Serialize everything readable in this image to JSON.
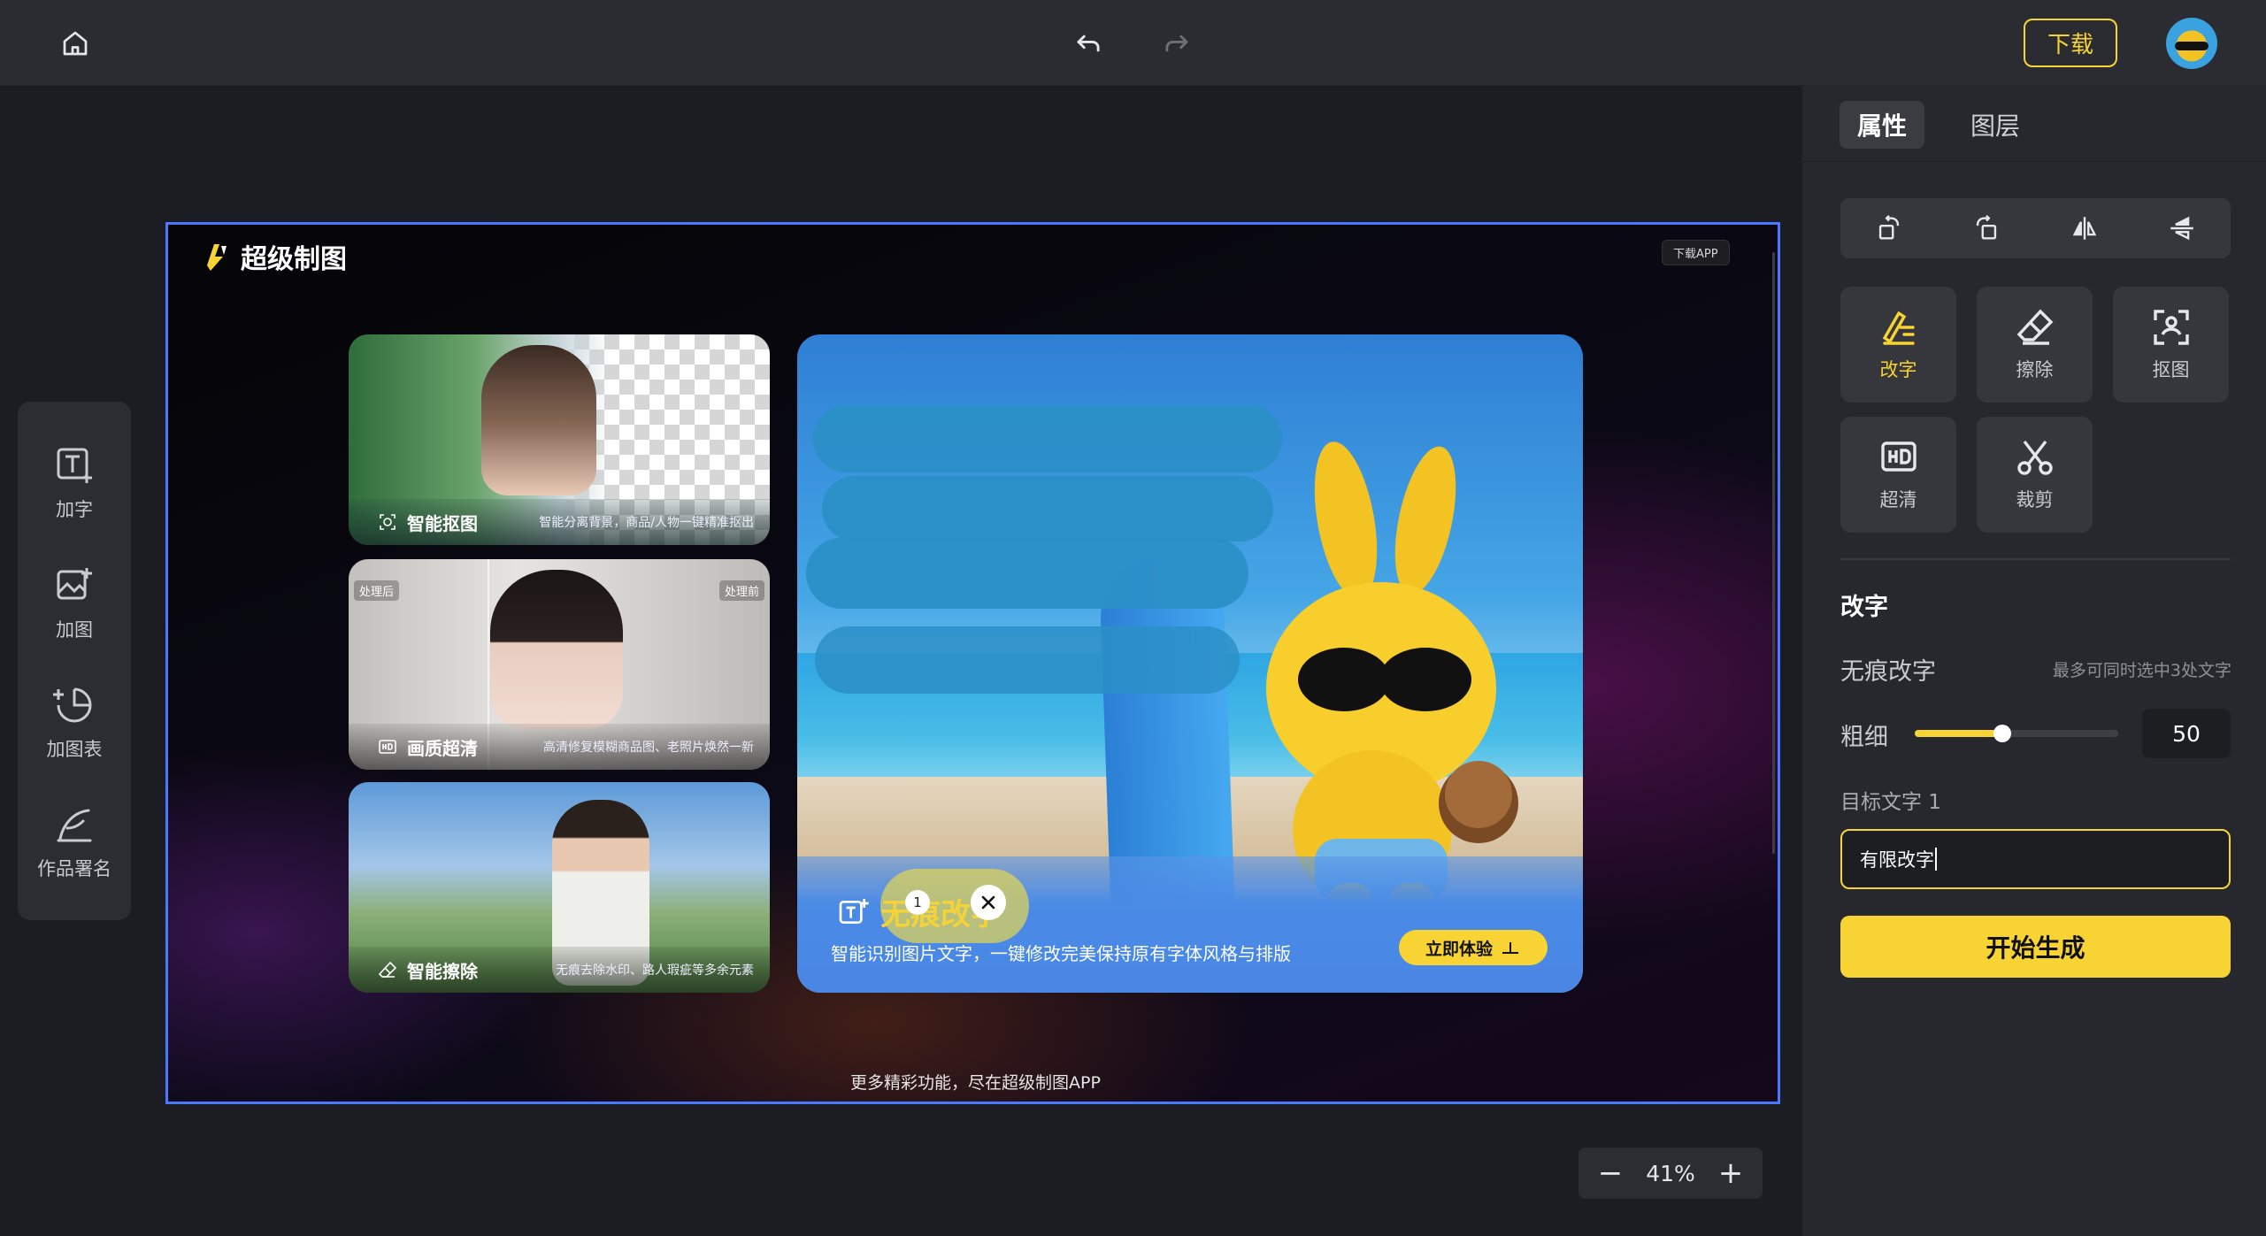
{
  "topbar": {
    "download_label": "下载",
    "icons": [
      "home-icon",
      "undo-icon",
      "redo-icon"
    ]
  },
  "left_tools": [
    {
      "label": "加字",
      "icon": "add-text-icon"
    },
    {
      "label": "加图",
      "icon": "add-image-icon"
    },
    {
      "label": "加图表",
      "icon": "add-chart-icon"
    },
    {
      "label": "作品署名",
      "icon": "signature-icon"
    }
  ],
  "canvas": {
    "logo_text": "超级制图",
    "download_app": "下载APP",
    "footer": "更多精彩功能，尽在超级制图APP",
    "cards": [
      {
        "title": "智能抠图",
        "desc": "智能分离背景，商品/人物一键精准抠出"
      },
      {
        "title": "画质超清",
        "desc": "高清修复模糊商品图、老照片焕然一新",
        "tag_left": "处理后",
        "tag_right": "处理前"
      },
      {
        "title": "智能擦除",
        "desc": "无痕去除水印、路人瑕疵等多余元素"
      }
    ],
    "main_card": {
      "title": "无痕改字",
      "desc": "智能识别图片文字，一键修改完美保持原有字体风格与排版",
      "cta": "立即体验",
      "marker_number": "1"
    }
  },
  "zoom": {
    "minus": "−",
    "value": "41%",
    "plus": "+"
  },
  "right_panel": {
    "tabs": [
      "属性",
      "图层"
    ],
    "transform_icons": [
      "rotate-right-icon",
      "rotate-left-icon",
      "flip-horizontal-icon",
      "flip-vertical-icon"
    ],
    "features": [
      {
        "label": "改字",
        "icon": "edit-text-icon",
        "active": true
      },
      {
        "label": "擦除",
        "icon": "eraser-icon",
        "active": false
      },
      {
        "label": "抠图",
        "icon": "cutout-icon",
        "active": false
      },
      {
        "label": "超清",
        "icon": "hd-icon",
        "active": false
      },
      {
        "label": "裁剪",
        "icon": "scissors-icon",
        "active": false
      }
    ],
    "section_title": "改字",
    "mode_label": "无痕改字",
    "mode_hint": "最多可同时选中3处文字",
    "thickness_label": "粗细",
    "thickness_value": "50",
    "thickness_fraction": 0.43,
    "target_label": "目标文字 1",
    "target_value": "有限改字",
    "generate_label": "开始生成"
  },
  "colors": {
    "accent": "#f7d433",
    "selection": "#4a79ff",
    "panel": "#26282d"
  }
}
